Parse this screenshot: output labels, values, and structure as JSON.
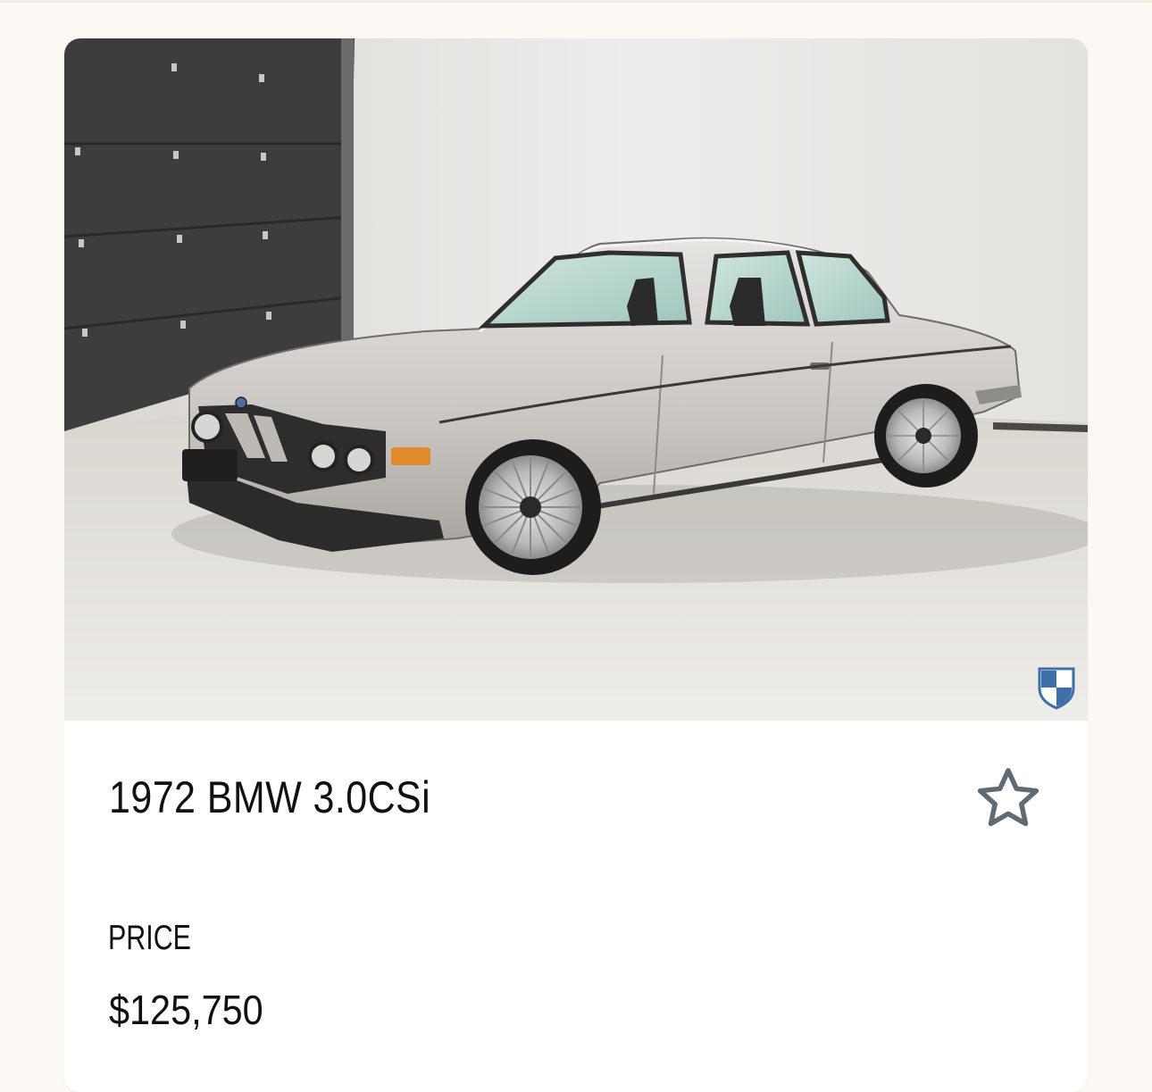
{
  "listing": {
    "title": "1972 BMW 3.0CSi",
    "price_label": "PRICE",
    "price": "$125,750",
    "photo_icon": "silver-bmw-coupe-photo",
    "badge_icon": "blue-white-shield-badge-icon",
    "favorite_icon": "star-outline-icon"
  },
  "colors": {
    "star_stroke": "#5f6b74",
    "badge_blue": "#3d6fa8",
    "page_bg": "#fcf9f5",
    "card_bg": "#ffffff"
  }
}
